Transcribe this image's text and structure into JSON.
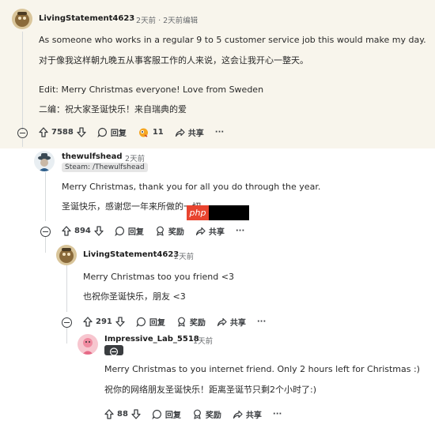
{
  "op": {
    "username": "LivingStatement4623",
    "time": "· 2天前 · 2天前编辑",
    "line1": "As someone who works in a regular 9 to 5 customer service job this would make my day.",
    "line1_zh": "对于像我这样朝九晚五从事客服工作的人来说，这会让我开心一整天。",
    "line2": "Edit: Merry Christmas everyone! Love from Sweden",
    "line2_zh": "二编：祝大家圣诞快乐！来自瑞典的爱",
    "votes": "7588",
    "reply": "回复",
    "award_count": "11",
    "share": "共享",
    "more": "···"
  },
  "reply1": {
    "username": "thewulfshead",
    "time": "· 2天前",
    "flair": "Steam: /Thewulfshead",
    "line1": "Merry Christmas, thank you for all you do through the year.",
    "line1_zh": "圣诞快乐，感谢您一年来所做的一切。",
    "votes": "894",
    "reply": "回复",
    "award": "奖励",
    "share": "共享",
    "more": "···"
  },
  "reply2": {
    "username": "LivingStatement4623",
    "time": "· 2天前",
    "line1": "Merry Christmas too you friend <3",
    "line1_zh": "也祝你圣诞快乐，朋友 <3",
    "votes": "291",
    "reply": "回复",
    "award": "奖励",
    "share": "共享",
    "more": "···"
  },
  "reply3": {
    "username": "Impressive_Lab_5518",
    "time": "· 1天前",
    "line1": "Merry Christmas to you internet friend. Only 2 hours left for Christmas :)",
    "line1_zh": "祝你的网络朋友圣诞快乐！距离圣诞节只剩2个小时了:)",
    "votes": "88",
    "reply": "回复",
    "award": "奖励",
    "share": "共享",
    "more": "···"
  },
  "watermark": {
    "text": "php"
  },
  "colors": {
    "highlight_bg": "#f8f5ec",
    "thread_line": "#d7dadc",
    "watermark_red": "#e8442f"
  }
}
